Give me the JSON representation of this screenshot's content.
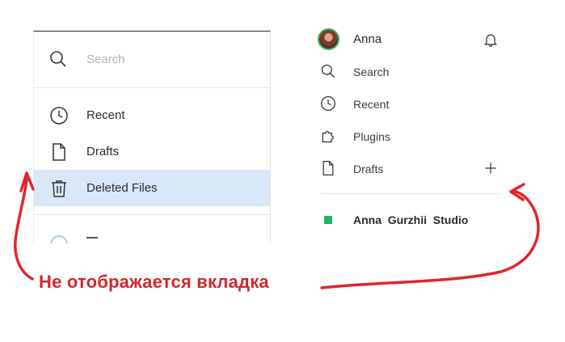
{
  "left_panel": {
    "search_placeholder": "Search",
    "items": [
      {
        "label": "Recent",
        "icon": "clock-icon"
      },
      {
        "label": "Drafts",
        "icon": "file-icon"
      },
      {
        "label": "Deleted Files",
        "icon": "trash-icon",
        "selected": true
      }
    ]
  },
  "right_panel": {
    "user_name": "Anna",
    "items": [
      {
        "label": "Search",
        "icon": "search-icon"
      },
      {
        "label": "Recent",
        "icon": "clock-icon"
      },
      {
        "label": "Plugins",
        "icon": "puzzle-icon"
      },
      {
        "label": "Drafts",
        "icon": "file-icon"
      }
    ],
    "team_name": "Anna_Gurzhii_Studio"
  },
  "annotation": {
    "text": "Не отображается вкладка",
    "color": "#d4262b"
  },
  "colors": {
    "selected_bg": "#d8e8f8",
    "team_accent": "#1bb46b"
  }
}
